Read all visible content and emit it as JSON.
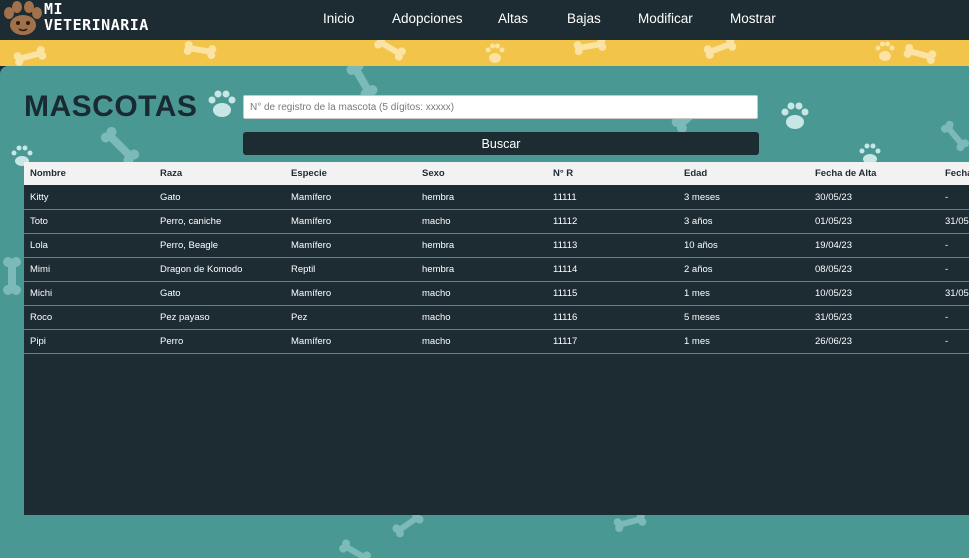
{
  "brand": {
    "line1": "MI",
    "line2": "VETERINARIA"
  },
  "nav": {
    "items": [
      {
        "label": "Inicio"
      },
      {
        "label": "Adopciones"
      },
      {
        "label": "Altas"
      },
      {
        "label": "Bajas"
      },
      {
        "label": "Modificar"
      },
      {
        "label": "Mostrar"
      }
    ]
  },
  "page": {
    "title": "MASCOTAS",
    "search_placeholder": "N° de registro de la mascota (5 dígitos: xxxxx)",
    "search_button": "Buscar"
  },
  "table": {
    "columns": [
      "Nombre",
      "Raza",
      "Especie",
      "Sexo",
      "N° R",
      "Edad",
      "Fecha de Alta",
      "Fecha"
    ],
    "rows": [
      [
        "Kitty",
        "Gato",
        "Mamífero",
        "hembra",
        "11111",
        "3 meses",
        "30/05/23",
        "-"
      ],
      [
        "Toto",
        "Perro, caniche",
        "Mamífero",
        "macho",
        "11112",
        "3 años",
        "01/05/23",
        "31/05"
      ],
      [
        "Lola",
        "Perro, Beagle",
        "Mamífero",
        "hembra",
        "11113",
        "10 años",
        "19/04/23",
        "-"
      ],
      [
        "Mimi",
        "Dragon de Komodo",
        "Reptil",
        "hembra",
        "11114",
        "2 años",
        "08/05/23",
        "-"
      ],
      [
        "Michi",
        "Gato",
        "Mamífero",
        "macho",
        "11115",
        "1 mes",
        "10/05/23",
        "31/05"
      ],
      [
        "Roco",
        "Pez payaso",
        "Pez",
        "macho",
        "11116",
        "5 meses",
        "31/05/23",
        "-"
      ],
      [
        "Pipi",
        "Perro",
        "Mamífero",
        "macho",
        "11117",
        "1 mes",
        "26/06/23",
        "-"
      ]
    ]
  },
  "colors": {
    "nav_bg": "#1d2b32",
    "band": "#f3c44a",
    "teal": "#4a9894",
    "decor": "#8cc6c6",
    "paw": "#c9e6e6"
  },
  "icons": [
    "paw-logo-icon",
    "bone-decoration",
    "paw-print-decoration"
  ]
}
